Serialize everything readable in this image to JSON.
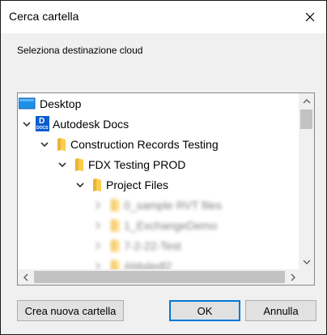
{
  "window": {
    "title": "Cerca cartella",
    "close_icon": "close-icon"
  },
  "instruction": "Seleziona destinazione cloud",
  "tree": {
    "items": [
      {
        "label": "Desktop",
        "icon": "desktop-icon",
        "expanded": false,
        "level": 0
      },
      {
        "label": "Autodesk Docs",
        "icon": "autodesk-docs-icon",
        "expanded": true,
        "level": 0
      },
      {
        "label": "Construction Records Testing",
        "icon": "folder-icon",
        "expanded": true,
        "level": 1
      },
      {
        "label": "FDX Testing PROD",
        "icon": "folder-icon",
        "expanded": true,
        "level": 2
      },
      {
        "label": "Project Files",
        "icon": "folder-icon",
        "expanded": true,
        "level": 3
      },
      {
        "label": "0_sample RVT files",
        "icon": "folder-icon",
        "expanded": false,
        "level": 4,
        "blurred": true
      },
      {
        "label": "1_ExchangeDemo",
        "icon": "folder-icon",
        "expanded": false,
        "level": 4,
        "blurred": true
      },
      {
        "label": "7-2-22-Test",
        "icon": "folder-icon",
        "expanded": false,
        "level": 4,
        "blurred": true
      },
      {
        "label": "Abbdedl2",
        "icon": "folder-icon",
        "expanded": false,
        "level": 4,
        "blurred": true
      }
    ],
    "docs_badge_top": "D",
    "docs_badge_bottom": "DOCS"
  },
  "buttons": {
    "new_folder": "Crea nuova cartella",
    "ok": "OK",
    "cancel": "Annulla"
  },
  "colors": {
    "accent": "#0078d7",
    "folder": "#ffcc4d",
    "docs_blue": "#0a5ccf"
  }
}
